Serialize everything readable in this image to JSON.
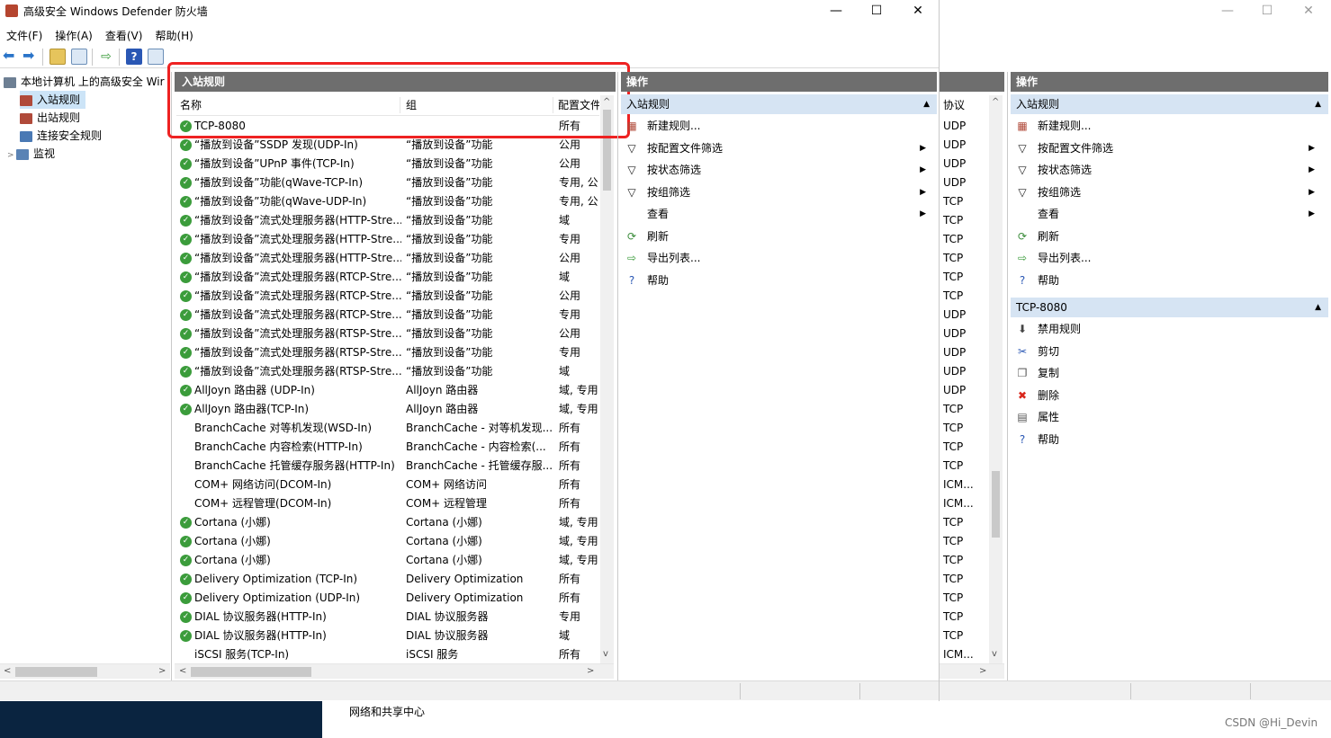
{
  "window": {
    "title": "高级安全 Windows Defender 防火墙",
    "minimize": "—",
    "maximize": "☐",
    "close": "✕"
  },
  "menu": [
    "文件(F)",
    "操作(A)",
    "查看(V)",
    "帮助(H)"
  ],
  "tree": {
    "root": "本地计算机 上的高级安全 Wir",
    "items": [
      "入站规则",
      "出站规则",
      "连接安全规则",
      "监视"
    ]
  },
  "list": {
    "header": "入站规则",
    "columns": [
      "名称",
      "组",
      "配置文件"
    ],
    "rows": [
      {
        "name": "TCP-8080",
        "group": "",
        "profile": "所有",
        "enabled": true
      },
      {
        "name": "“播放到设备”SSDP 发现(UDP-In)",
        "group": "“播放到设备”功能",
        "profile": "公用",
        "enabled": true
      },
      {
        "name": "“播放到设备”UPnP 事件(TCP-In)",
        "group": "“播放到设备”功能",
        "profile": "公用",
        "enabled": true
      },
      {
        "name": "“播放到设备”功能(qWave-TCP-In)",
        "group": "“播放到设备”功能",
        "profile": "专用, 公",
        "enabled": true
      },
      {
        "name": "“播放到设备”功能(qWave-UDP-In)",
        "group": "“播放到设备”功能",
        "profile": "专用, 公",
        "enabled": true
      },
      {
        "name": "“播放到设备”流式处理服务器(HTTP-Stre...",
        "group": "“播放到设备”功能",
        "profile": "域",
        "enabled": true
      },
      {
        "name": "“播放到设备”流式处理服务器(HTTP-Stre...",
        "group": "“播放到设备”功能",
        "profile": "专用",
        "enabled": true
      },
      {
        "name": "“播放到设备”流式处理服务器(HTTP-Stre...",
        "group": "“播放到设备”功能",
        "profile": "公用",
        "enabled": true
      },
      {
        "name": "“播放到设备”流式处理服务器(RTCP-Stre...",
        "group": "“播放到设备”功能",
        "profile": "域",
        "enabled": true
      },
      {
        "name": "“播放到设备”流式处理服务器(RTCP-Stre...",
        "group": "“播放到设备”功能",
        "profile": "公用",
        "enabled": true
      },
      {
        "name": "“播放到设备”流式处理服务器(RTCP-Stre...",
        "group": "“播放到设备”功能",
        "profile": "专用",
        "enabled": true
      },
      {
        "name": "“播放到设备”流式处理服务器(RTSP-Stre...",
        "group": "“播放到设备”功能",
        "profile": "公用",
        "enabled": true
      },
      {
        "name": "“播放到设备”流式处理服务器(RTSP-Stre...",
        "group": "“播放到设备”功能",
        "profile": "专用",
        "enabled": true
      },
      {
        "name": "“播放到设备”流式处理服务器(RTSP-Stre...",
        "group": "“播放到设备”功能",
        "profile": "域",
        "enabled": true
      },
      {
        "name": "AllJoyn 路由器 (UDP-In)",
        "group": "AllJoyn 路由器",
        "profile": "域, 专用",
        "enabled": true
      },
      {
        "name": "AllJoyn 路由器(TCP-In)",
        "group": "AllJoyn 路由器",
        "profile": "域, 专用",
        "enabled": true
      },
      {
        "name": "BranchCache 对等机发现(WSD-In)",
        "group": "BranchCache - 对等机发现...",
        "profile": "所有",
        "enabled": false
      },
      {
        "name": "BranchCache 内容检索(HTTP-In)",
        "group": "BranchCache - 内容检索(...",
        "profile": "所有",
        "enabled": false
      },
      {
        "name": "BranchCache 托管缓存服务器(HTTP-In)",
        "group": "BranchCache - 托管缓存服...",
        "profile": "所有",
        "enabled": false
      },
      {
        "name": "COM+ 网络访问(DCOM-In)",
        "group": "COM+ 网络访问",
        "profile": "所有",
        "enabled": false
      },
      {
        "name": "COM+ 远程管理(DCOM-In)",
        "group": "COM+ 远程管理",
        "profile": "所有",
        "enabled": false
      },
      {
        "name": "Cortana (小娜)",
        "group": "Cortana (小娜)",
        "profile": "域, 专用",
        "enabled": true
      },
      {
        "name": "Cortana (小娜)",
        "group": "Cortana (小娜)",
        "profile": "域, 专用",
        "enabled": true
      },
      {
        "name": "Cortana (小娜)",
        "group": "Cortana (小娜)",
        "profile": "域, 专用",
        "enabled": true
      },
      {
        "name": "Delivery Optimization (TCP-In)",
        "group": "Delivery Optimization",
        "profile": "所有",
        "enabled": true
      },
      {
        "name": "Delivery Optimization (UDP-In)",
        "group": "Delivery Optimization",
        "profile": "所有",
        "enabled": true
      },
      {
        "name": "DIAL 协议服务器(HTTP-In)",
        "group": "DIAL 协议服务器",
        "profile": "专用",
        "enabled": true
      },
      {
        "name": "DIAL 协议服务器(HTTP-In)",
        "group": "DIAL 协议服务器",
        "profile": "域",
        "enabled": true
      },
      {
        "name": "iSCSI 服务(TCP-In)",
        "group": "iSCSI 服务",
        "profile": "所有",
        "enabled": false
      }
    ]
  },
  "actions_mid": {
    "header": "操作",
    "section": "入站规则",
    "items": [
      "新建规则...",
      "按配置文件筛选",
      "按状态筛选",
      "按组筛选",
      "查看",
      "刷新",
      "导出列表...",
      "帮助"
    ]
  },
  "protocol": {
    "header": "协议",
    "values": [
      "UDP",
      "UDP",
      "UDP",
      "UDP",
      "TCP",
      "TCP",
      "TCP",
      "TCP",
      "TCP",
      "TCP",
      "UDP",
      "UDP",
      "UDP",
      "UDP",
      "UDP",
      "TCP",
      "TCP",
      "TCP",
      "TCP",
      "ICM...",
      "ICM...",
      "TCP",
      "TCP",
      "TCP",
      "TCP",
      "TCP",
      "TCP",
      "TCP",
      "ICM..."
    ]
  },
  "actions_right": {
    "header": "操作",
    "section": "入站规则",
    "items": [
      "新建规则...",
      "按配置文件筛选",
      "按状态筛选",
      "按组筛选",
      "查看",
      "刷新",
      "导出列表...",
      "帮助"
    ],
    "section2": "TCP-8080",
    "items2": [
      "禁用规则",
      "剪切",
      "复制",
      "删除",
      "属性",
      "帮助"
    ]
  },
  "taskbar_text": "网络和共享中心",
  "watermark": "CSDN @Hi_Devin"
}
